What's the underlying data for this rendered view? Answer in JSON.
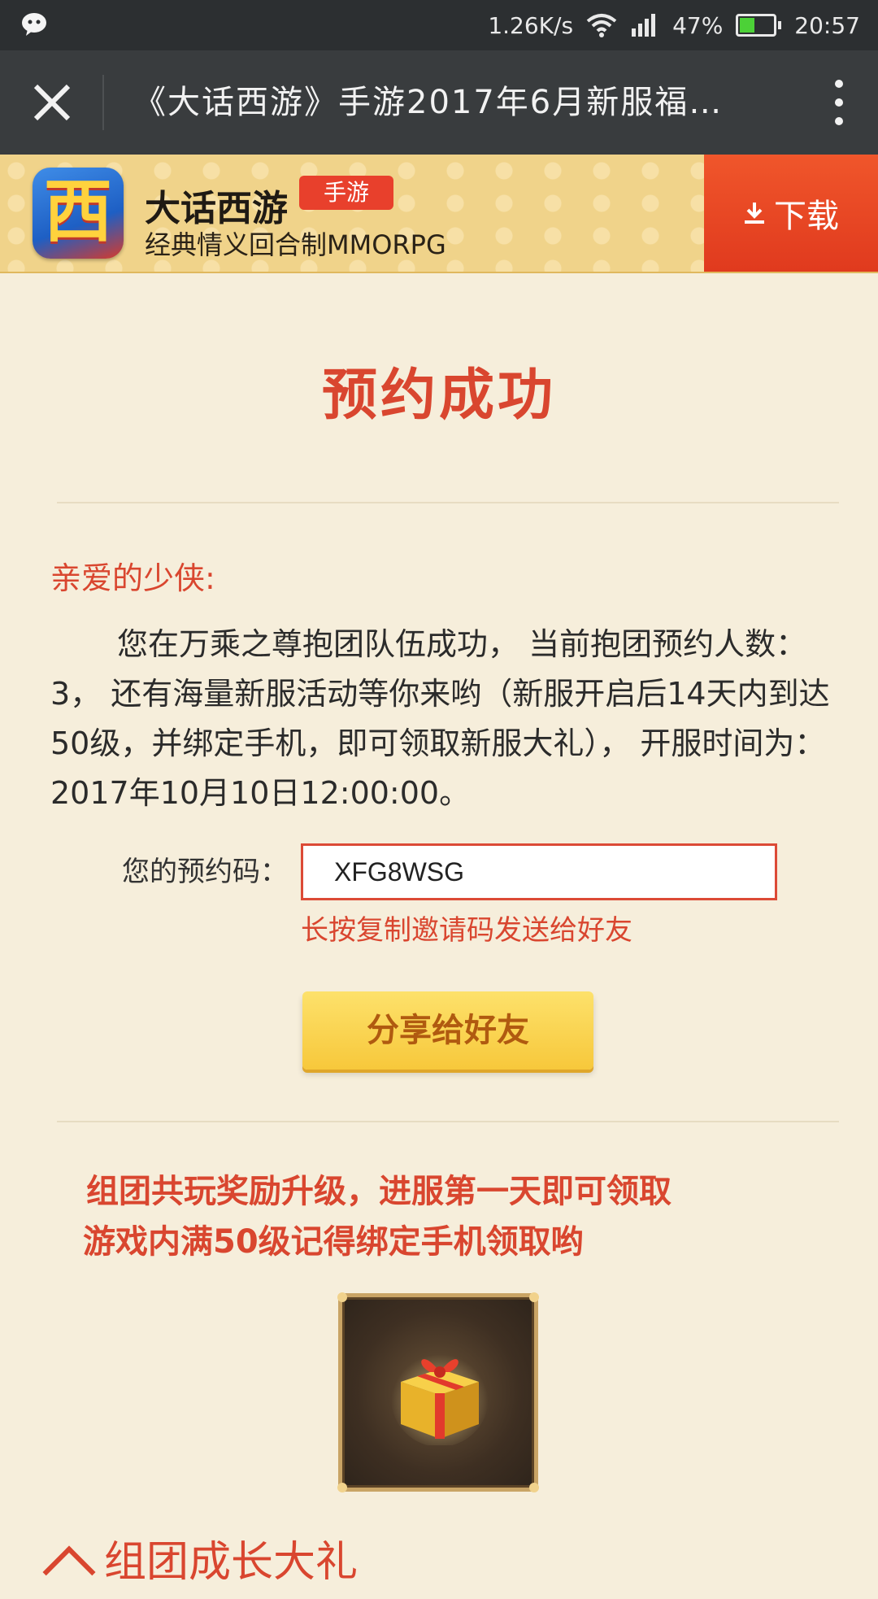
{
  "status_bar": {
    "network_speed": "1.26K/s",
    "battery": "47%",
    "battery_level": 0.47,
    "time": "20:57"
  },
  "title_bar": {
    "title": "《大话西游》手游2017年6月新服福…"
  },
  "app_banner": {
    "name": "大话西游",
    "tag": "手游",
    "subtitle": "经典情义回合制MMORPG",
    "download_label": "下载",
    "icon_glyph": "西"
  },
  "main": {
    "title": "预约成功",
    "greeting": "亲爱的少侠:",
    "body": "您在万乘之尊抱团队伍成功， 当前抱团预约人数：3， 还有海量新服活动等你来哟（新服开启后14天内到达50级，并绑定手机，即可领取新服大礼）， 开服时间为：2017年10月10日12:00:00。",
    "code_label": "您的预约码：",
    "code_value": "XFG8WSG",
    "code_hint": "长按复制邀请码发送给好友",
    "share_label": "分享给好友",
    "promo_line1": "组团共玩奖励升级，进服第一天即可领取",
    "promo_line2": "游戏内满50级记得绑定手机领取哟",
    "section_heading": "组团成长大礼"
  },
  "colors": {
    "accent_red": "#d9462f",
    "page_bg": "#f6eedb",
    "share_yellow": "#f7c83b"
  }
}
